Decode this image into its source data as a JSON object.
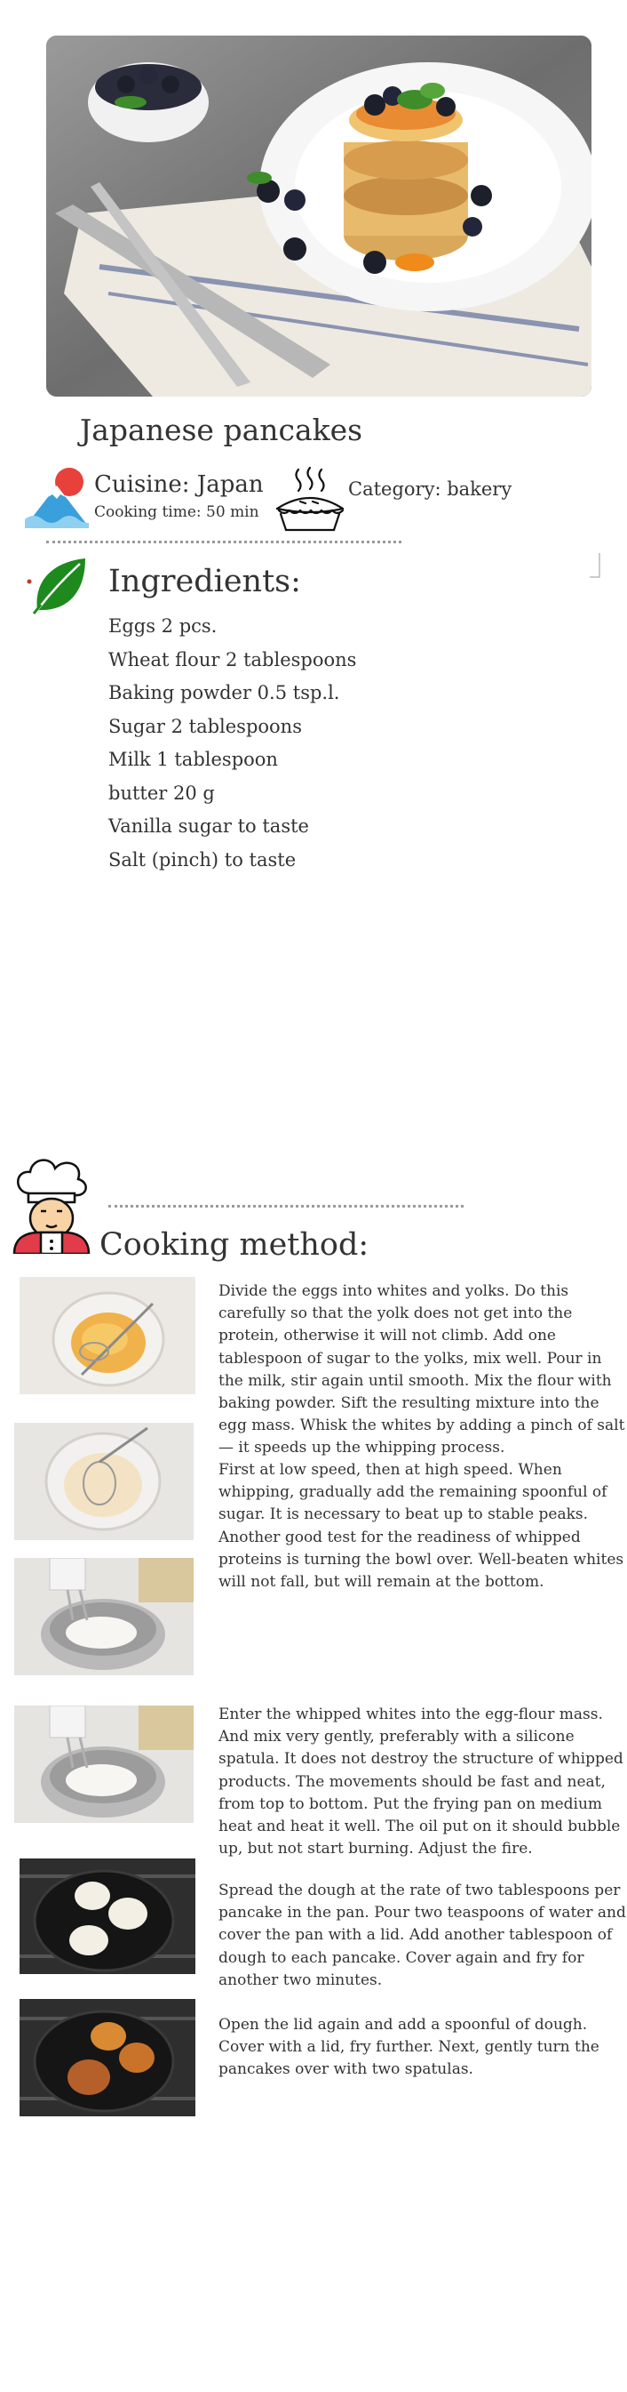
{
  "recipe": {
    "title": "Japanese pancakes",
    "cuisine": "Cuisine: Japan",
    "cooking_time": "Cooking time: 50 min",
    "category": "Category: bakery"
  },
  "icons": {
    "cuisine": "mount-fuji-icon",
    "category": "pie-icon",
    "ingredients": "leaf-icon",
    "method": "chef-icon"
  },
  "ingredients": {
    "title": "Ingredients:",
    "items": [
      "Eggs 2 pcs.",
      "Wheat flour 2 tablespoons",
      "Baking powder 0.5 tsp.l.",
      "Sugar  2 tablespoons",
      "Milk 1 tablespoon",
      "butter 20 g",
      "Vanilla sugar to taste",
      "Salt (pinch) to taste"
    ]
  },
  "method": {
    "title": "Cooking method:",
    "steps": [
      "Divide the eggs into whites and yolks. Do this carefully so that the yolk does not get into the protein, otherwise it will not climb. Add one tablespoon of sugar to the yolks, mix well. Pour in the milk, stir again until smooth. Mix the flour with baking powder. Sift the resulting mixture into the egg mass. Whisk the whites by adding a pinch of salt — it speeds up the whipping process.",
      "First at low speed, then at high speed. When whipping, gradually add the remaining spoonful of sugar. It is necessary to beat up to stable peaks. Another good test for the readiness of whipped proteins is turning the bowl over. Well-beaten whites will not fall, but will remain at the bottom.",
      "Enter the whipped whites into the egg-flour mass. And mix very gently, preferably with a silicone spatula. It does not destroy the structure of whipped products. The movements should be fast and neat, from top to bottom. Put the frying pan on medium heat and heat it well. The oil put on it should bubble up, but not start burning. Adjust the fire.",
      "Spread the dough at the rate of two tablespoons per pancake in the pan. Pour two teaspoons of water and cover the pan with a lid. Add another tablespoon of dough to each pancake. Cover again and fry for another two minutes.",
      "Open the lid again and add a spoonful of dough. Cover with a lid, fry further. Next, gently turn the pancakes over with two spatulas."
    ]
  },
  "colors": {
    "leaf": "#1e8a1e",
    "sun": "#e8413c",
    "chef_apron": "#e23b4a"
  }
}
